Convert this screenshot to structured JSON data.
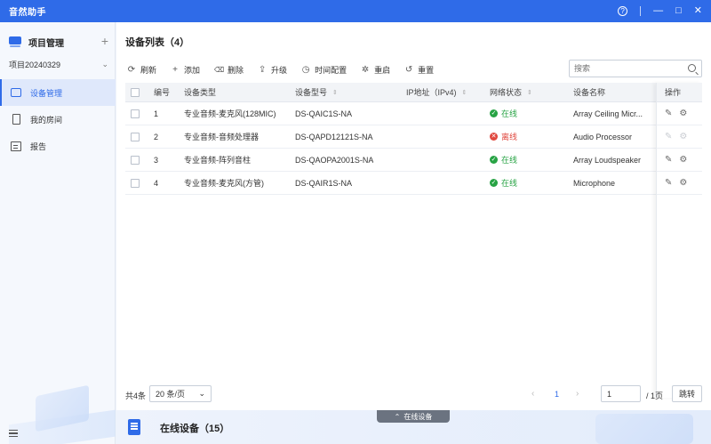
{
  "app": {
    "title": "音然助手"
  },
  "window_controls": {
    "help": "?",
    "minimize": "—",
    "maximize": "□",
    "close": "✕"
  },
  "sidebar": {
    "header": "项目管理",
    "add": "+",
    "project": "项目20240329",
    "items": [
      {
        "label": "设备管理",
        "icon": "device-icon",
        "active": true
      },
      {
        "label": "我的房间",
        "icon": "room-icon",
        "active": false
      },
      {
        "label": "报告",
        "icon": "report-icon",
        "active": false
      }
    ]
  },
  "main": {
    "title": "设备列表（4）",
    "toolbar": [
      {
        "label": "刷新",
        "icon": "refresh-icon",
        "glyph": "⟳"
      },
      {
        "label": "添加",
        "icon": "plus-icon",
        "glyph": "+"
      },
      {
        "label": "删除",
        "icon": "trash-icon",
        "glyph": "🗑"
      },
      {
        "label": "升级",
        "icon": "upload-icon",
        "glyph": "⇪"
      },
      {
        "label": "时间配置",
        "icon": "clock-icon",
        "glyph": "◷"
      },
      {
        "label": "重启",
        "icon": "restart-icon",
        "glyph": "✲"
      },
      {
        "label": "重置",
        "icon": "reset-icon",
        "glyph": "↺"
      }
    ],
    "search": {
      "placeholder": "搜索"
    },
    "table": {
      "headers": {
        "no": "编号",
        "type": "设备类型",
        "model": "设备型号",
        "ip": "IP地址（IPv4)",
        "status": "网络状态",
        "name": "设备名称",
        "op": "操作"
      },
      "rows": [
        {
          "no": "1",
          "type": "专业音频-麦克风(128MIC)",
          "model": "DS-QAIC1S-NA",
          "ip": "",
          "status": "在线",
          "online": true,
          "name": "Array Ceiling Micr..."
        },
        {
          "no": "2",
          "type": "专业音频-音频处理器",
          "model": "DS-QAPD12121S-NA",
          "ip": "",
          "status": "离线",
          "online": false,
          "name": "Audio Processor"
        },
        {
          "no": "3",
          "type": "专业音频-阵列音柱",
          "model": "DS-QAOPA2001S-NA",
          "ip": "",
          "status": "在线",
          "online": true,
          "name": "Array Loudspeaker"
        },
        {
          "no": "4",
          "type": "专业音频-麦克风(方管)",
          "model": "DS-QAIR1S-NA",
          "ip": "",
          "status": "在线",
          "online": true,
          "name": "Microphone"
        }
      ]
    },
    "pagination": {
      "total": "共4条",
      "page_size": "20 条/页",
      "current": "1",
      "page_input": "1",
      "page_total": "/ 1页",
      "go": "跳转"
    }
  },
  "bottom_panel": {
    "tab": "在线设备",
    "title": "在线设备（15）"
  },
  "colors": {
    "primary": "#2f6be8",
    "online": "#27a344",
    "offline": "#e0483f"
  }
}
